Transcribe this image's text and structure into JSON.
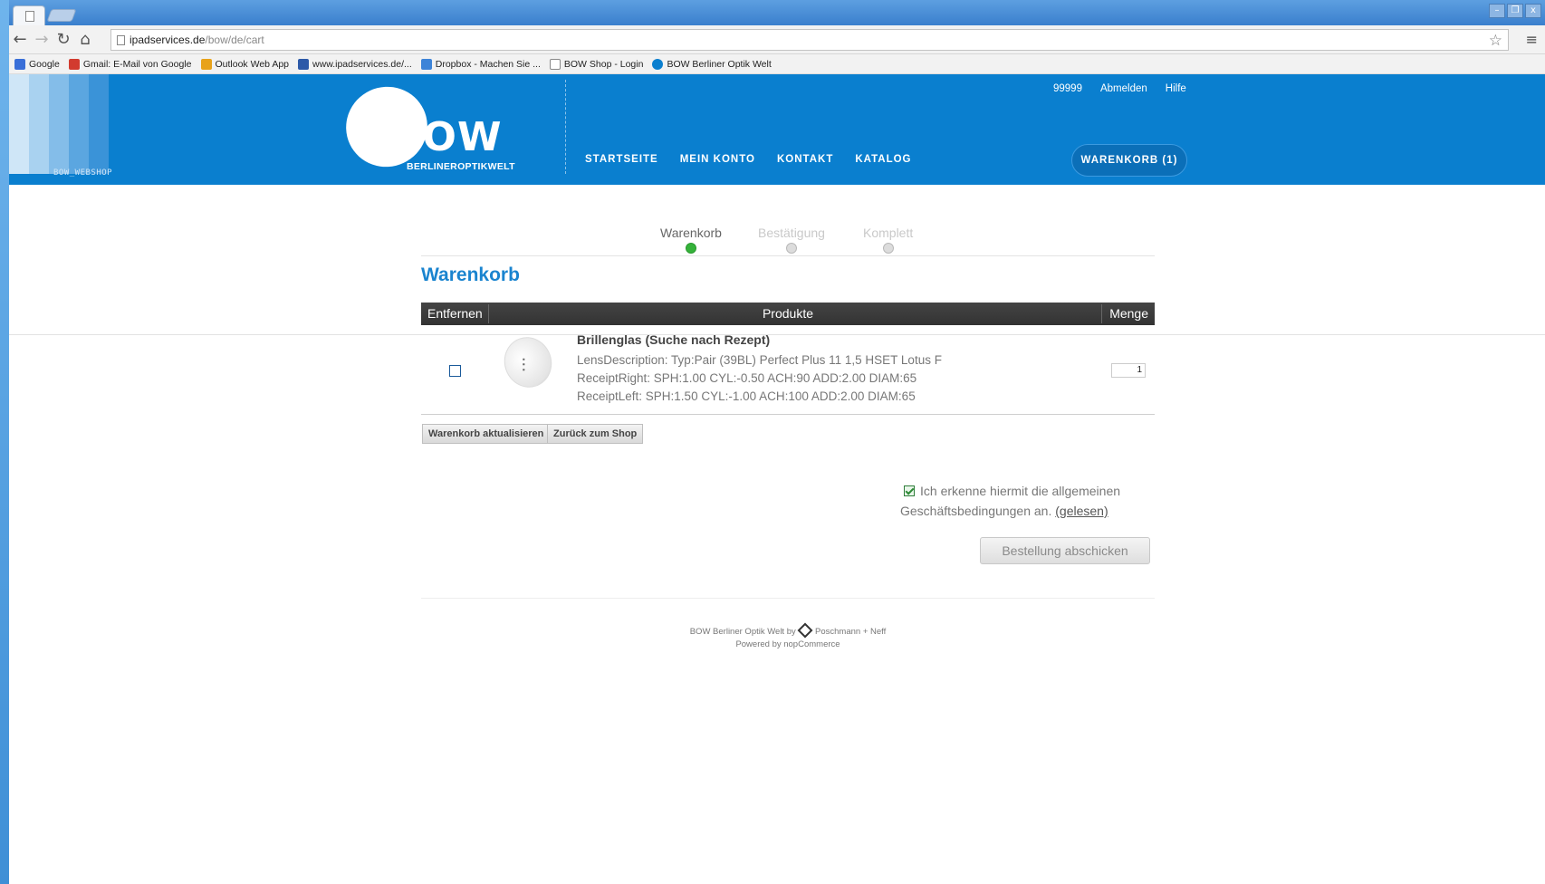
{
  "browser": {
    "url_host": "ipadservices.de",
    "url_path": "/bow/de/cart",
    "window_controls": [
      "–",
      "❐",
      "x"
    ],
    "bookmarks": [
      {
        "label": "Google",
        "color": "#3a6fd8"
      },
      {
        "label": "Gmail: E-Mail von Google",
        "color": "#d23b2f"
      },
      {
        "label": "Outlook Web App",
        "color": "#e8a21a"
      },
      {
        "label": "www.ipadservices.de/...",
        "color": "#2d5aa8"
      },
      {
        "label": "Dropbox - Machen Sie ...",
        "color": "#3d84d8"
      },
      {
        "label": "BOW Shop - Login",
        "color": "#ffffff"
      },
      {
        "label": "BOW Berliner Optik Welt",
        "color": "#0a7fcf"
      }
    ]
  },
  "header": {
    "webshop_label": "BOW_WEBSHOP",
    "logo_text": "BOW",
    "logo_sub": "BERLINEROPTIKWELT",
    "top_links": [
      "99999",
      "Abmelden",
      "Hilfe"
    ],
    "nav": [
      "STARTSEITE",
      "MEIN KONTO",
      "KONTAKT",
      "KATALOG"
    ],
    "cart_button": "WARENKORB (1)",
    "brand_color": "#0a7fcf"
  },
  "steps": [
    {
      "label": "Warenkorb",
      "state": "active"
    },
    {
      "label": "Bestätigung",
      "state": "pending"
    },
    {
      "label": "Komplett",
      "state": "pending"
    }
  ],
  "page_title": "Warenkorb",
  "table": {
    "headers": {
      "remove": "Entfernen",
      "products": "Produkte",
      "qty": "Menge"
    },
    "rows": [
      {
        "name": "Brillenglas (Suche nach Rezept)",
        "attributes": [
          "LensDescription: Typ:Pair (39BL) Perfect Plus 11 1,5 HSET Lotus F",
          "ReceiptRight: SPH:1.00 CYL:-0.50 ACH:90 ADD:2.00 DIAM:65",
          "ReceiptLeft: SPH:1.50 CYL:-1.00 ACH:100 ADD:2.00 DIAM:65"
        ],
        "quantity": "1",
        "remove_checked": false,
        "image_icon": "sliders-icon"
      }
    ]
  },
  "buttons": {
    "update_cart": "Warenkorb aktualisieren",
    "continue_shopping": "Zurück zum Shop",
    "checkout": "Bestellung abschicken"
  },
  "terms": {
    "text": "Ich erkenne hiermit die allgemeinen Geschäftsbedingungen an.",
    "link": "(gelesen)",
    "checked": true
  },
  "footer": {
    "line1_left": "BOW Berliner Optik Welt by",
    "line1_right": "Poschmann + Neff",
    "line2": "Powered by nopCommerce"
  }
}
